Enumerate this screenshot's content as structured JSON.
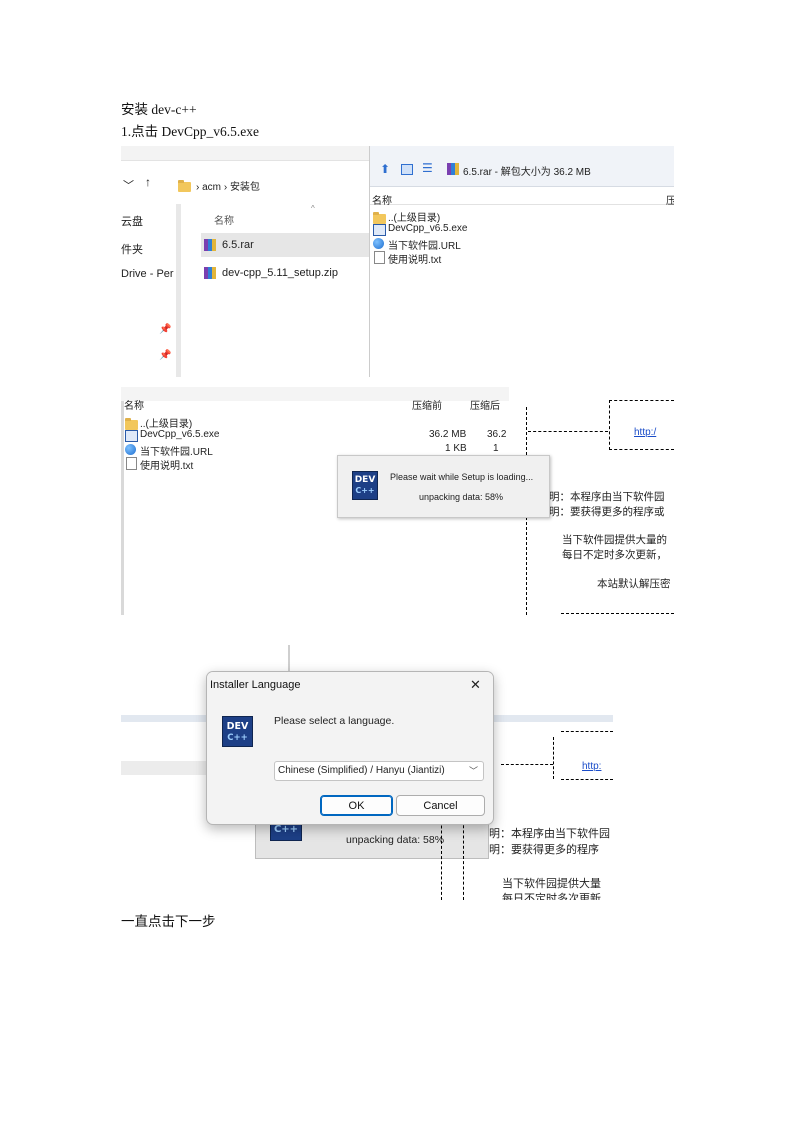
{
  "doc": {
    "heading": "安装 dev-c++",
    "step1": "1.点击 DevCpp_v6.5.exe",
    "closing": "一直点击下一步"
  },
  "explorer": {
    "breadcrumb": [
      "acm",
      "安装包"
    ],
    "left_nav": [
      "云盘",
      "件夹",
      "Drive - Per"
    ],
    "column_header": "名称",
    "files": [
      "6.5.rar",
      "dev-cpp_5.11_setup.zip"
    ]
  },
  "archive_top": {
    "title": "6.5.rar - 解包大小为 36.2 MB",
    "column_header": "名称",
    "column_right": "压",
    "items": [
      "..(上级目录)",
      "DevCpp_v6.5.exe",
      "当下软件园.URL",
      "使用说明.txt"
    ]
  },
  "archive_mid": {
    "columns": [
      "名称",
      "压缩前",
      "压缩后"
    ],
    "rows": [
      {
        "name": "..(上级目录)",
        "before": "",
        "after": ""
      },
      {
        "name": "DevCpp_v6.5.exe",
        "before": "36.2 MB",
        "after": "36.2"
      },
      {
        "name": "当下软件园.URL",
        "before": "1 KB",
        "after": "1"
      },
      {
        "name": "使用说明.txt",
        "before": "",
        "after": ""
      }
    ],
    "side_link": "http:/",
    "side_lines": [
      "明：本程序由当下软件园",
      "明：要获得更多的程序或",
      "当下软件园提供大量的",
      "每日不定时多次更新，",
      "本站默认解压密"
    ]
  },
  "setup_loading": {
    "logo_top": "DEV",
    "logo_bottom": "C++",
    "line1": "Please wait while Setup is loading...",
    "line2": "unpacking data: 58%",
    "progress_percent": 58
  },
  "lang_dialog": {
    "title": "Installer Language",
    "close_glyph": "✕",
    "prompt": "Please select a language.",
    "selected_language": "Chinese (Simplified) / Hanyu (Jiantizi)",
    "ok_label": "OK",
    "cancel_label": "Cancel"
  },
  "bottom_bg": {
    "unpacking": "unpacking data: 58%",
    "side_link": "http:",
    "side_lines": [
      "明：本程序由当下软件园",
      "明：要获得更多的程序",
      "当下软件园提供大量",
      "每日不定时多次更新"
    ]
  }
}
